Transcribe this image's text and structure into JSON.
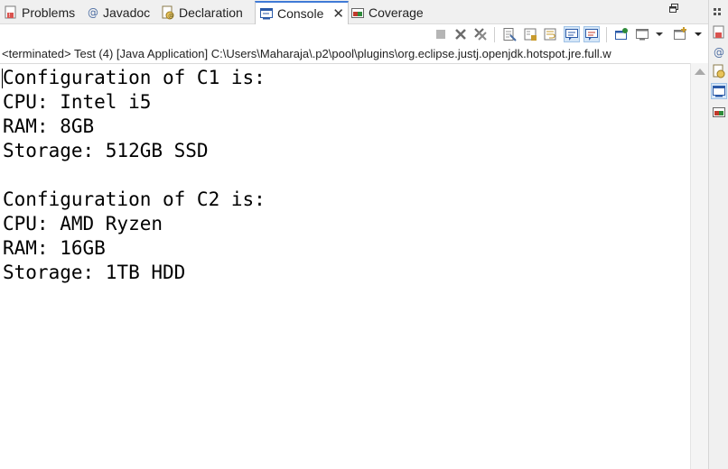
{
  "tabs": [
    {
      "label": "Problems",
      "icon": "problems-icon"
    },
    {
      "label": "Javadoc",
      "icon": "javadoc-icon"
    },
    {
      "label": "Declaration",
      "icon": "declaration-icon"
    },
    {
      "label": "Console",
      "icon": "console-icon",
      "active": true
    },
    {
      "label": "Coverage",
      "icon": "coverage-icon"
    }
  ],
  "console": {
    "description": "<terminated> Test (4) [Java Application] C:\\Users\\Maharaja\\.p2\\pool\\plugins\\org.eclipse.justj.openjdk.hotspot.jre.full.w",
    "lines": [
      "Configuration of C1 is:",
      "CPU: Intel i5",
      "RAM: 8GB",
      "Storage: 512GB SSD",
      "",
      "Configuration of C2 is:",
      "CPU: AMD Ryzen",
      "RAM: 16GB",
      "Storage: 1TB HDD"
    ]
  },
  "toolbar_icons": [
    "terminate-icon",
    "remove-launch-icon",
    "remove-all-terminated-icon",
    "clear-console-icon",
    "scroll-lock-icon",
    "word-wrap-icon",
    "show-on-stdout-icon",
    "show-on-stderr-icon",
    "pin-console-icon",
    "display-console-icon",
    "display-console-dropdown-icon",
    "open-console-icon",
    "open-console-dropdown-icon",
    "view-menu-icon"
  ],
  "trim_icons": [
    "problems-icon",
    "javadoc-icon",
    "declaration-icon",
    "console-icon",
    "coverage-icon"
  ],
  "colors": {
    "accent": "#3f7ad6",
    "console_text": "#000000",
    "panel_bg": "#f0f0f0"
  }
}
